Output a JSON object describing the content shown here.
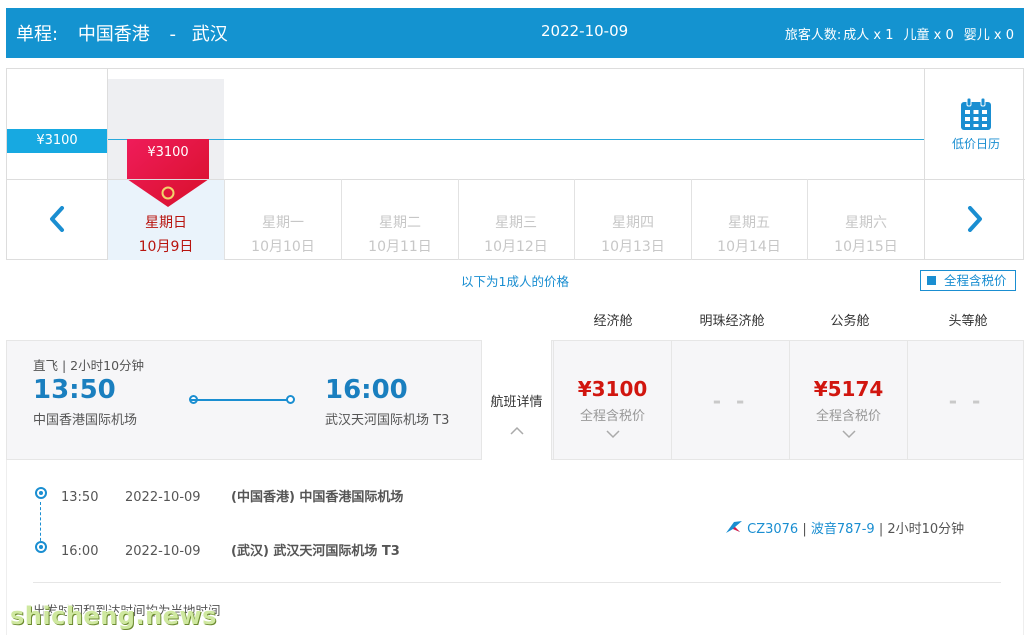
{
  "header": {
    "trip_type": "单程:",
    "origin": "中国香港",
    "dash": "-",
    "destination": "武汉",
    "date": "2022-10-09",
    "pax_label": "旅客人数:",
    "adult": "成人 x 1",
    "child": "儿童 x 0",
    "infant": "婴儿 x 0",
    "bg_color": "#1493d0"
  },
  "calendar": {
    "lowest_price_label": "¥3100",
    "selected_price": "¥3100",
    "calendar_link_label": "低价日历",
    "days": [
      {
        "weekday": "星期日",
        "date": "10月9日",
        "active": true
      },
      {
        "weekday": "星期一",
        "date": "10月10日",
        "active": false
      },
      {
        "weekday": "星期二",
        "date": "10月11日",
        "active": false
      },
      {
        "weekday": "星期三",
        "date": "10月12日",
        "active": false
      },
      {
        "weekday": "星期四",
        "date": "10月13日",
        "active": false
      },
      {
        "weekday": "星期五",
        "date": "10月14日",
        "active": false
      },
      {
        "weekday": "星期六",
        "date": "10月15日",
        "active": false
      }
    ]
  },
  "subtitle": "以下为1成人的价格",
  "tax_toggle_label": "全程含税价",
  "cabins": [
    "经济舱",
    "明珠经济舱",
    "公务舱",
    "头等舱"
  ],
  "flight": {
    "meta": "直飞 | 2小时10分钟",
    "dep_time": "13:50",
    "dep_airport": "中国香港国际机场",
    "arr_time": "16:00",
    "arr_airport": "武汉天河国际机场 T3",
    "detail_label": "航班详情",
    "fares": [
      {
        "amount": "¥3100",
        "note": "全程含税价"
      },
      {
        "amount": "- -",
        "note": ""
      },
      {
        "amount": "¥5174",
        "note": "全程含税价"
      },
      {
        "amount": "- -",
        "note": ""
      }
    ]
  },
  "segments": [
    {
      "time": "13:50",
      "date": "2022-10-09",
      "airport": "(中国香港) 中国香港国际机场"
    },
    {
      "time": "16:00",
      "date": "2022-10-09",
      "airport": "(武汉) 武汉天河国际机场 T3"
    }
  ],
  "flight_info": {
    "number": "CZ3076",
    "aircraft": "波音787-9",
    "duration": "2小时10分钟",
    "sep": "|"
  },
  "footnote": "出发时间和到达时间均为当地时间",
  "watermark": "shicheng.news",
  "colors": {
    "accent": "#1a8ed1",
    "price_red": "#d1160f",
    "flag_red": "#e8163e"
  }
}
